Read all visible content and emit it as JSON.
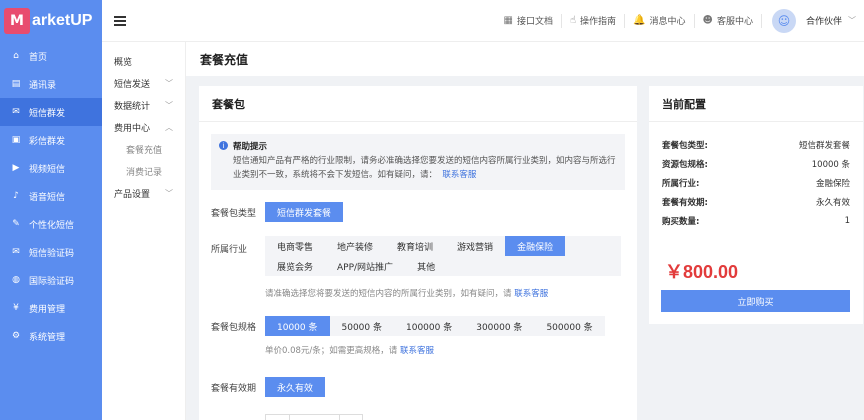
{
  "brand": {
    "logo_text": "arketUP",
    "logo_mark": "M"
  },
  "sidebar": {
    "items": [
      {
        "label": "首页",
        "icon": "home-icon",
        "glyph": "⌂"
      },
      {
        "label": "通讯录",
        "icon": "contacts-icon",
        "glyph": "▤"
      },
      {
        "label": "短信群发",
        "icon": "sms-group-icon",
        "glyph": "✉"
      },
      {
        "label": "彩信群发",
        "icon": "mms-icon",
        "glyph": "▣"
      },
      {
        "label": "视频短信",
        "icon": "video-icon",
        "glyph": "▶"
      },
      {
        "label": "语音短信",
        "icon": "voice-icon",
        "glyph": "♪"
      },
      {
        "label": "个性化短信",
        "icon": "personal-sms-icon",
        "glyph": "✎"
      },
      {
        "label": "短信验证码",
        "icon": "verify-code-icon",
        "glyph": "✉"
      },
      {
        "label": "国际验证码",
        "icon": "intl-code-icon",
        "glyph": "◍"
      },
      {
        "label": "费用管理",
        "icon": "fee-icon",
        "glyph": "¥"
      },
      {
        "label": "系统管理",
        "icon": "settings-icon",
        "glyph": "⚙"
      }
    ],
    "active_index": 2
  },
  "submenu": {
    "items": [
      {
        "label": "概览",
        "chevron": ""
      },
      {
        "label": "短信发送",
        "chevron": "﹀"
      },
      {
        "label": "数据统计",
        "chevron": "﹀"
      },
      {
        "label": "费用中心",
        "chevron": "︿"
      }
    ],
    "children": [
      "套餐充值",
      "消费记录"
    ],
    "last": {
      "label": "产品设置",
      "chevron": "﹀"
    }
  },
  "topbar": {
    "links": [
      {
        "label": "接口文档",
        "icon": "api-doc-icon",
        "glyph": "▦"
      },
      {
        "label": "操作指南",
        "icon": "guide-icon",
        "glyph": "☝"
      },
      {
        "label": "消息中心",
        "icon": "bell-icon",
        "glyph": "🔔"
      },
      {
        "label": "客服中心",
        "icon": "support-icon",
        "glyph": "☻"
      }
    ],
    "user_name": "合作伙伴",
    "user_chevron": "﹀"
  },
  "page": {
    "title": "套餐充值"
  },
  "package_card": {
    "title": "套餐包",
    "help_title": "帮助提示",
    "help_text": "短信通知产品有严格的行业限制，请务必准确选择您要发送的短信内容所属行业类别，如内容与所选行业类别不一致，系统将不会下发短信。如有疑问，请：",
    "help_link": "联系客服",
    "type_label": "套餐包类型",
    "type_value": "短信群发套餐",
    "industry_label": "所属行业",
    "industries": [
      "电商零售",
      "地产装修",
      "教育培训",
      "游戏营销",
      "金融保险",
      "展览会务",
      "APP/网站推广",
      "其他"
    ],
    "industry_selected": 4,
    "industry_hint": "请准确选择您将要发送的短信内容的所属行业类别，如有疑问，请",
    "industry_hint_link": "联系客服",
    "spec_label": "套餐包规格",
    "specs": [
      "10000 条",
      "50000 条",
      "100000 条",
      "300000 条",
      "500000 条"
    ],
    "spec_selected": 0,
    "spec_hint": "单价0.08元/条；如需更高规格，请",
    "spec_hint_link": "联系客服",
    "validity_label": "套餐有效期",
    "validity_value": "永久有效"
  },
  "config_card": {
    "title": "当前配置",
    "rows": [
      {
        "k": "套餐包类型:",
        "v": "短信群发套餐"
      },
      {
        "k": "资源包规格:",
        "v": "10000 条"
      },
      {
        "k": "所属行业:",
        "v": "金融保险"
      },
      {
        "k": "套餐有效期:",
        "v": "永久有效"
      },
      {
        "k": "购买数量:",
        "v": "1"
      }
    ],
    "price": "￥800.00",
    "buy_label": "立即购买"
  }
}
